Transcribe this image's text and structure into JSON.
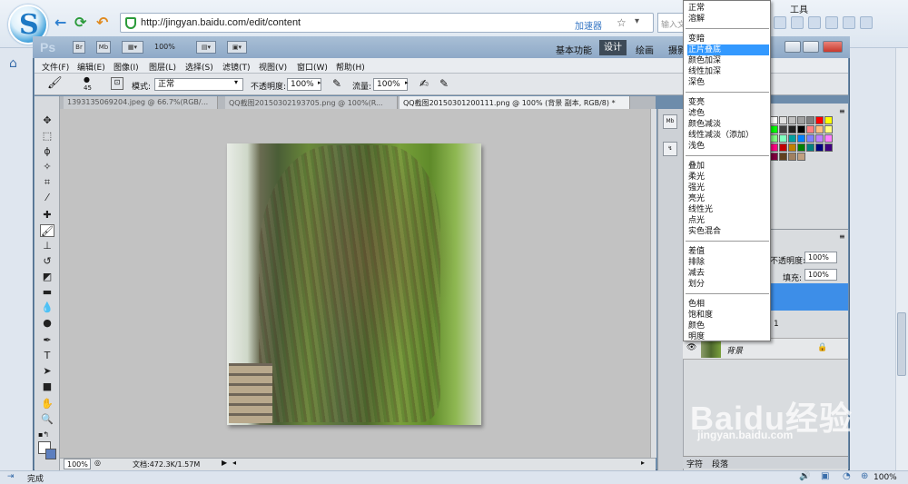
{
  "browser": {
    "url": "http://jingyan.baidu.com/edit/content",
    "accelerator": "加速器",
    "search_placeholder": "输入文",
    "tools_label": "工具",
    "status": "完成",
    "zoom": "100%",
    "watermark": "Baidu经验",
    "watermark_url": "jingyan.baidu.com"
  },
  "ps": {
    "logo": "Ps",
    "btn_br": "Br",
    "btn_mb": "Mb",
    "zoom_select": "100%",
    "workspaces": {
      "basic": "基本功能",
      "design": "设计",
      "draw": "绘画",
      "photo": "摄影"
    },
    "menus": [
      "文件(F)",
      "编辑(E)",
      "图像(I)",
      "图层(L)",
      "选择(S)",
      "滤镜(T)",
      "视图(V)",
      "窗口(W)",
      "帮助(H)"
    ],
    "options": {
      "brush_size": "45",
      "mode_label": "模式:",
      "mode_value": "正常",
      "opacity_label": "不透明度:",
      "opacity_value": "100%",
      "flow_label": "流量:",
      "flow_value": "100%"
    },
    "tabs": [
      "1393135069204.jpeg @ 66.7%(RGB/...",
      "QQ截图20150302193705.png @ 100%(R...",
      "QQ截图20150301200111.png @ 100% (背景 副本, RGB/8) *"
    ],
    "status_zoom": "100%",
    "doc_info": "文档:472.3K/1.57M",
    "layers": {
      "opacity_label": "不透明度:",
      "opacity_value": "100%",
      "fill_label": "填充:",
      "fill_value": "100%",
      "layer_copy_suffix": "1",
      "bg_layer": "背景"
    },
    "bottom_tabs": [
      "字符",
      "段落"
    ]
  },
  "dropdown": {
    "groups": [
      [
        "正常",
        "溶解"
      ],
      [
        "变暗",
        "正片叠底",
        "颜色加深",
        "线性加深",
        "深色"
      ],
      [
        "变亮",
        "滤色",
        "颜色减淡",
        "线性减淡（添加）",
        "浅色"
      ],
      [
        "叠加",
        "柔光",
        "强光",
        "亮光",
        "线性光",
        "点光",
        "实色混合"
      ],
      [
        "差值",
        "排除",
        "减去",
        "划分"
      ],
      [
        "色相",
        "饱和度",
        "颜色",
        "明度"
      ]
    ],
    "selected": "正片叠底"
  },
  "colors": {
    "selection": "#3399ff",
    "layer_selected": "#3d8ee8"
  }
}
